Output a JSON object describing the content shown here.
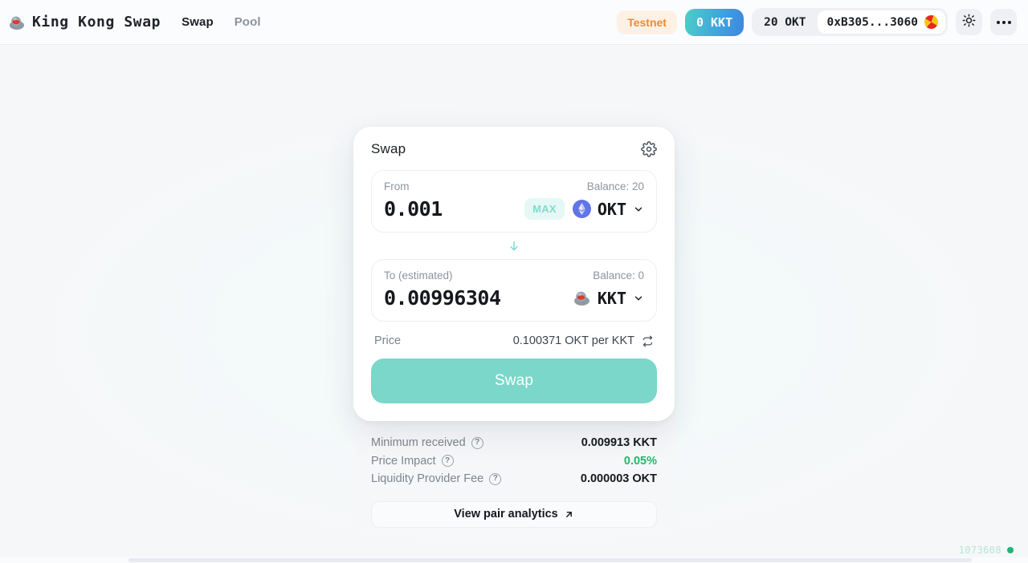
{
  "header": {
    "brand_icon": "kong-logo-icon",
    "brand_title": "King Kong Swap",
    "nav": [
      {
        "label": "Swap",
        "active": true
      },
      {
        "label": "Pool",
        "active": false
      }
    ],
    "network_badge": "Testnet",
    "token_badge": "0 KKT",
    "wallet_balance": "20 OKT",
    "wallet_address": "0xB305...3060",
    "avatar_icon": "wallet-blockie-avatar",
    "theme_toggle_icon": "sun-icon",
    "more_menu_icon": "more-dots-icon",
    "colors": {
      "testnet_text": "#f08a32",
      "testnet_bg": "#fdf1e6",
      "kkt_gradient_from": "#4ccfc4",
      "kkt_gradient_to": "#3d86e0"
    }
  },
  "swap_card": {
    "title": "Swap",
    "settings_icon": "gear-icon",
    "from": {
      "label": "From",
      "balance": "Balance: 20",
      "amount": "0.001",
      "amount_placeholder": "0.0",
      "max_label": "MAX",
      "token": "OKT",
      "token_icon": "okt-token-icon",
      "chevron_icon": "chevron-down-icon"
    },
    "switch_icon": "arrow-down-icon",
    "to": {
      "label": "To (estimated)",
      "balance": "Balance: 0",
      "amount": "0.00996304",
      "amount_placeholder": "0.0",
      "token": "KKT",
      "token_icon": "kkt-token-icon",
      "chevron_icon": "chevron-down-icon"
    },
    "price": {
      "label": "Price",
      "value": "0.100371 OKT per KKT",
      "invert_icon": "swap-rate-icon"
    },
    "action_label": "Swap",
    "action_color": "#7ad7c9"
  },
  "details": {
    "rows": [
      {
        "label": "Minimum received",
        "help_icon": "help-circle-icon",
        "value": "0.009913 KKT",
        "accent": false
      },
      {
        "label": "Price Impact",
        "help_icon": "help-circle-icon",
        "value": "0.05%",
        "accent": true
      },
      {
        "label": "Liquidity Provider Fee",
        "help_icon": "help-circle-icon",
        "value": "0.000003 OKT",
        "accent": false
      }
    ],
    "analytics_label": "View pair analytics",
    "analytics_icon": "external-link-arrow-icon",
    "help_glyph": "?"
  },
  "status": {
    "block_number": "1073608",
    "indicator_color": "#22b573"
  }
}
